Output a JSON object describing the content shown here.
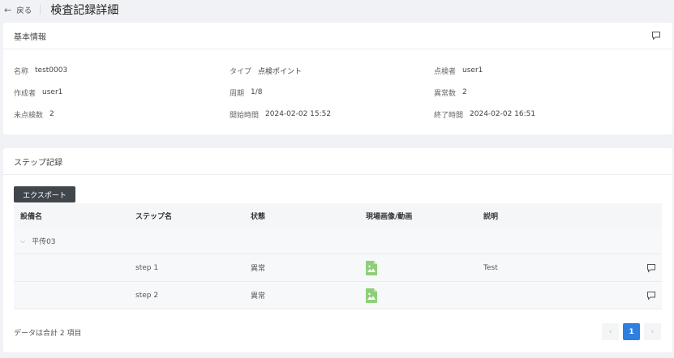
{
  "header": {
    "back_label": "戻る",
    "title": "検査記録詳細"
  },
  "basic": {
    "title": "基本情報",
    "fields": [
      {
        "label": "名称",
        "value": "test0003"
      },
      {
        "label": "タイプ",
        "value": "点検ポイント"
      },
      {
        "label": "点検者",
        "value": "user1"
      },
      {
        "label": "作成者",
        "value": "user1"
      },
      {
        "label": "周期",
        "value": "1/8"
      },
      {
        "label": "異常数",
        "value": "2"
      },
      {
        "label": "未点検数",
        "value": "2"
      },
      {
        "label": "開始時間",
        "value": "2024-02-02 15:52"
      },
      {
        "label": "終了時間",
        "value": "2024-02-02 16:51"
      }
    ]
  },
  "steps": {
    "title": "ステップ記録",
    "export_label": "エクスポート",
    "columns": [
      "設備名",
      "ステップ名",
      "状態",
      "現場画像/動画",
      "説明"
    ],
    "group": "平传03",
    "rows": [
      {
        "step": "step 1",
        "status": "異常",
        "note": "Test"
      },
      {
        "step": "step 2",
        "status": "異常",
        "note": ""
      }
    ],
    "total_text": "データは合計 2 項目",
    "page": "1",
    "prev": "‹",
    "next": "›"
  },
  "colors": {
    "accent": "#2f7fe0",
    "export_bg": "#41464d",
    "image_icon": "#8fcf7a"
  },
  "icons": [
    "back-arrow-icon",
    "comment-icon",
    "chevron-down-icon",
    "image-icon"
  ]
}
